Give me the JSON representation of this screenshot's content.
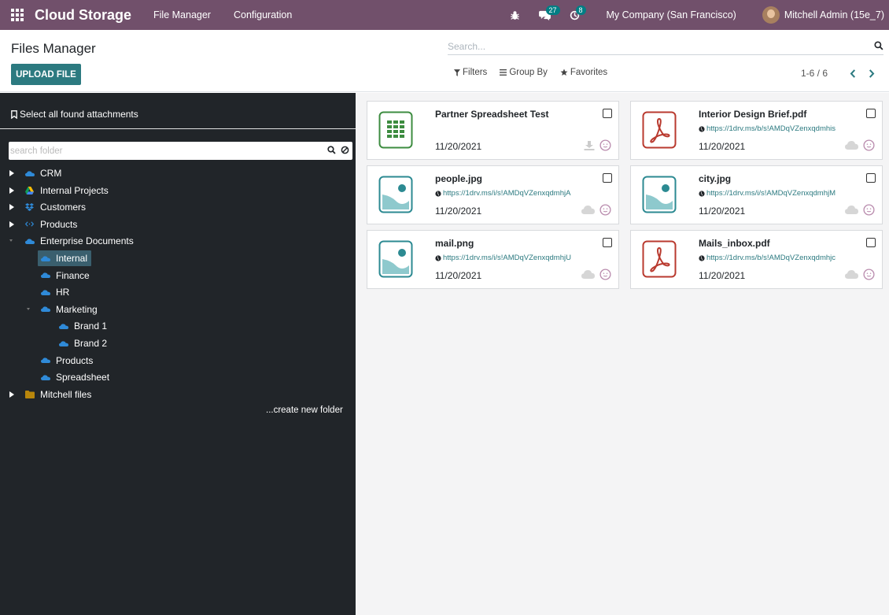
{
  "navbar": {
    "brand": "Cloud Storage",
    "menus": [
      "File Manager",
      "Configuration"
    ],
    "messages_count": "27",
    "activities_count": "8",
    "company": "My Company (San Francisco)",
    "user": "Mitchell Admin (15e_7)"
  },
  "control": {
    "title": "Files Manager",
    "upload_label": "UPLOAD FILE",
    "search_placeholder": "Search...",
    "filters_label": "Filters",
    "groupby_label": "Group By",
    "favorites_label": "Favorites",
    "pager_value": "1-6 / 6"
  },
  "sidebar": {
    "select_all_label": "Select all found attachments",
    "search_placeholder": "search folder",
    "create_folder_label": "...create new folder",
    "tree": [
      {
        "label": "CRM",
        "icon": "onedrive-icon",
        "level": 0,
        "state": "collapsed"
      },
      {
        "label": "Internal Projects",
        "icon": "google-drive-icon",
        "level": 0,
        "state": "collapsed"
      },
      {
        "label": "Customers",
        "icon": "dropbox-icon",
        "level": 0,
        "state": "collapsed"
      },
      {
        "label": "Products",
        "icon": "code-icon",
        "level": 0,
        "state": "collapsed"
      },
      {
        "label": "Enterprise Documents",
        "icon": "onedrive-icon",
        "level": 0,
        "state": "expanded"
      },
      {
        "label": "Internal",
        "icon": "onedrive-icon",
        "level": 1,
        "state": "leaf",
        "active": true
      },
      {
        "label": "Finance",
        "icon": "onedrive-icon",
        "level": 1,
        "state": "leaf"
      },
      {
        "label": "HR",
        "icon": "onedrive-icon",
        "level": 1,
        "state": "leaf"
      },
      {
        "label": "Marketing",
        "icon": "onedrive-icon",
        "level": 1,
        "state": "expanded"
      },
      {
        "label": "Brand 1",
        "icon": "onedrive-icon",
        "level": 2,
        "state": "leaf"
      },
      {
        "label": "Brand 2",
        "icon": "onedrive-icon",
        "level": 2,
        "state": "leaf"
      },
      {
        "label": "Products",
        "icon": "onedrive-icon",
        "level": 1,
        "state": "leaf"
      },
      {
        "label": "Spreadsheet",
        "icon": "onedrive-icon",
        "level": 1,
        "state": "leaf"
      },
      {
        "label": "Mitchell files",
        "icon": "folder-icon",
        "level": 0,
        "state": "collapsed"
      }
    ]
  },
  "files": [
    {
      "name": "Partner Spreadsheet Test",
      "type": "spreadsheet",
      "url": "",
      "date": "11/20/2021",
      "status_icon": "download-icon"
    },
    {
      "name": "Interior Design Brief.pdf",
      "type": "pdf",
      "url": "https://1drv.ms/b/s!AMDqVZenxqdmhis",
      "date": "11/20/2021",
      "status_icon": "cloud-icon"
    },
    {
      "name": "people.jpg",
      "type": "image",
      "url": "https://1drv.ms/i/s!AMDqVZenxqdmhjA",
      "date": "11/20/2021",
      "status_icon": "cloud-icon"
    },
    {
      "name": "city.jpg",
      "type": "image",
      "url": "https://1drv.ms/i/s!AMDqVZenxqdmhjM",
      "date": "11/20/2021",
      "status_icon": "cloud-icon"
    },
    {
      "name": "mail.png",
      "type": "image",
      "url": "https://1drv.ms/i/s!AMDqVZenxqdmhjU",
      "date": "11/20/2021",
      "status_icon": "cloud-icon"
    },
    {
      "name": "Mails_inbox.pdf",
      "type": "pdf",
      "url": "https://1drv.ms/b/s!AMDqVZenxqdmhjc",
      "date": "11/20/2021",
      "status_icon": "cloud-icon"
    }
  ],
  "colors": {
    "navbar": "#71506b",
    "primary_button": "#2c7a80",
    "sidebar": "#212529",
    "spreadsheet_icon": "#3d8c40",
    "pdf_icon": "#b93a2f",
    "image_icon": "#2c8a92",
    "link": "#2c7a80"
  }
}
